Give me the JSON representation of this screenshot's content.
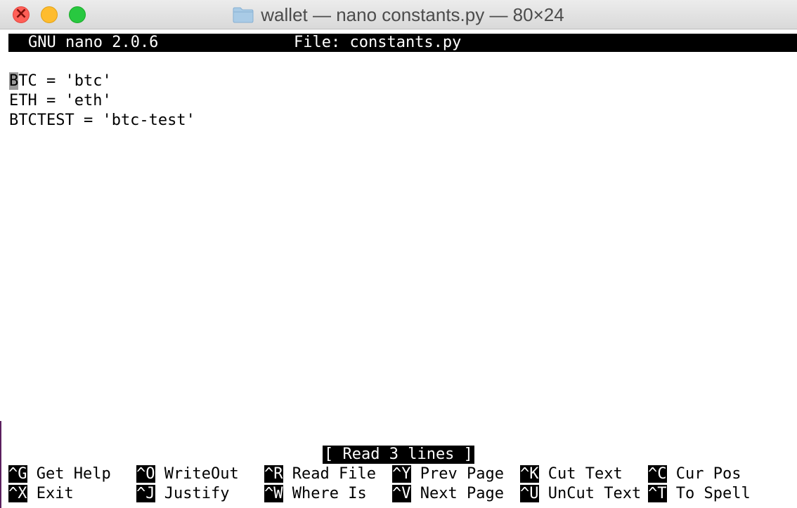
{
  "window": {
    "title": "wallet — nano constants.py — 80×24"
  },
  "nano": {
    "version": "GNU nano 2.0.6",
    "file_label": "File: constants.py",
    "cursor_char": "B",
    "lines": [
      "TC = 'btc'",
      "ETH = 'eth'",
      "BTCTEST = 'btc-test'"
    ],
    "status": "[ Read 3 lines ]",
    "shortcuts_row1": [
      {
        "key": "^G",
        "label": " Get Help"
      },
      {
        "key": "^O",
        "label": " WriteOut"
      },
      {
        "key": "^R",
        "label": " Read File"
      },
      {
        "key": "^Y",
        "label": " Prev Page"
      },
      {
        "key": "^K",
        "label": " Cut Text"
      },
      {
        "key": "^C",
        "label": " Cur Pos"
      }
    ],
    "shortcuts_row2": [
      {
        "key": "^X",
        "label": " Exit"
      },
      {
        "key": "^J",
        "label": " Justify"
      },
      {
        "key": "^W",
        "label": " Where Is"
      },
      {
        "key": "^V",
        "label": " Next Page"
      },
      {
        "key": "^U",
        "label": " UnCut Text"
      },
      {
        "key": "^T",
        "label": " To Spell"
      }
    ]
  },
  "icons": {
    "folder": "folder-icon"
  }
}
